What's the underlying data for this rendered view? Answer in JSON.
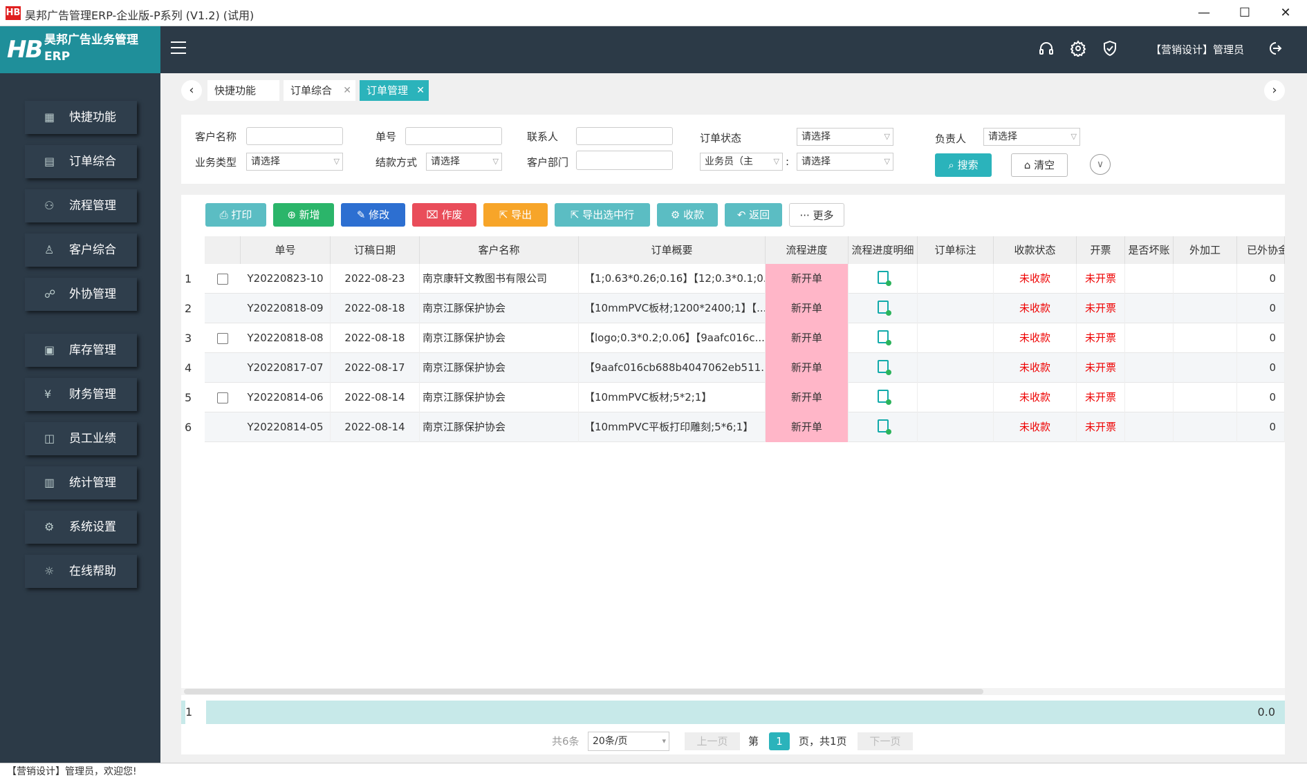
{
  "window": {
    "logo": "HB",
    "title": "昊邦广告管理ERP-企业版-P系列 (V1.2) (试用)",
    "minimize": "—",
    "maximize": "☐",
    "close": "✕"
  },
  "brand": {
    "logo": "HB",
    "name_line1": "昊邦广告业务管理",
    "name_line2": "ERP"
  },
  "header": {
    "user": "【营销设计】管理员",
    "icons": [
      "headset-icon",
      "gear-icon",
      "shield-check-icon",
      "logout-icon"
    ]
  },
  "sidebar": {
    "items": [
      {
        "label": "快捷功能",
        "icon": "grid-icon"
      },
      {
        "label": "订单综合",
        "icon": "clipboard-icon"
      },
      {
        "label": "流程管理",
        "icon": "flow-icon"
      },
      {
        "label": "客户综合",
        "icon": "user-icon"
      },
      {
        "label": "外协管理",
        "icon": "handshake-icon"
      },
      {
        "label": "库存管理",
        "icon": "inventory-icon"
      },
      {
        "label": "财务管理",
        "icon": "yen-icon"
      },
      {
        "label": "员工业绩",
        "icon": "chart-icon"
      },
      {
        "label": "统计管理",
        "icon": "bar-chart-icon"
      },
      {
        "label": "系统设置",
        "icon": "gear-icon"
      },
      {
        "label": "在线帮助",
        "icon": "bulb-icon"
      }
    ]
  },
  "tabs": [
    {
      "label": "快捷功能",
      "closable": false
    },
    {
      "label": "订单综合",
      "closable": true
    },
    {
      "label": "订单管理",
      "closable": true,
      "active": true
    }
  ],
  "filters": {
    "customer_name": "客户名称",
    "order_no": "单号",
    "contact": "联系人",
    "order_status": "订单状态",
    "order_status_value": "请选择",
    "owner": "负责人",
    "owner_value": "请选择",
    "biz_type": "业务类型",
    "biz_type_value": "请选择",
    "settle": "结款方式",
    "settle_value": "请选择",
    "dept": "客户部门",
    "salesman": "业务员（主",
    "salesman_sep": ":",
    "salesman_value": "请选择",
    "search": "搜索",
    "clear": "清空"
  },
  "toolbar": {
    "print": "打印",
    "add": "新增",
    "edit": "修改",
    "void": "作废",
    "export": "导出",
    "export_sel": "导出选中行",
    "collect": "收款",
    "back": "返回",
    "more": "更多"
  },
  "table": {
    "headers": [
      "单号",
      "订稿日期",
      "客户名称",
      "订单概要",
      "流程进度",
      "流程进度明细",
      "订单标注",
      "收款状态",
      "开票",
      "是否坏账",
      "外加工",
      "已外协金"
    ],
    "rows": [
      {
        "no": "1",
        "id": "Y20220823-10",
        "date": "2022-08-23",
        "customer": "南京康轩文教图书有限公司",
        "summary": "【1;0.63*0.26;0.16】【12;0.3*0.1;0...",
        "progress": "新开单",
        "pay": "未收款",
        "invoice": "未开票",
        "amount": "0"
      },
      {
        "no": "2",
        "id": "Y20220818-09",
        "date": "2022-08-18",
        "customer": "南京江豚保护协会",
        "summary": "【10mmPVC板材;1200*2400;1】【...",
        "progress": "新开单",
        "pay": "未收款",
        "invoice": "未开票",
        "amount": "0"
      },
      {
        "no": "3",
        "id": "Y20220818-08",
        "date": "2022-08-18",
        "customer": "南京江豚保护协会",
        "summary": "【logo;0.3*0.2;0.06】【9aafc016c...",
        "progress": "新开单",
        "pay": "未收款",
        "invoice": "未开票",
        "amount": "0"
      },
      {
        "no": "4",
        "id": "Y20220817-07",
        "date": "2022-08-17",
        "customer": "南京江豚保护协会",
        "summary": "【9aafc016cb688b4047062eb511...",
        "progress": "新开单",
        "pay": "未收款",
        "invoice": "未开票",
        "amount": "0"
      },
      {
        "no": "5",
        "id": "Y20220814-06",
        "date": "2022-08-14",
        "customer": "南京江豚保护协会",
        "summary": "【10mmPVC板材;5*2;1】",
        "progress": "新开单",
        "pay": "未收款",
        "invoice": "未开票",
        "amount": "0"
      },
      {
        "no": "6",
        "id": "Y20220814-05",
        "date": "2022-08-14",
        "customer": "南京江豚保护协会",
        "summary": "【10mmPVC平板打印雕刻;5*6;1】",
        "progress": "新开单",
        "pay": "未收款",
        "invoice": "未开票",
        "amount": "0"
      }
    ],
    "summary_no": "1",
    "summary_value": "0.0"
  },
  "pager": {
    "total": "共6条",
    "per_page": "20条/页",
    "prev": "上一页",
    "page_prefix": "第",
    "current": "1",
    "page_suffix": "页，共1页",
    "next": "下一页"
  },
  "status": "【营销设计】管理员，欢迎您!",
  "colors": {
    "accent": "#2bb3bb",
    "sidebar": "#2c3a47",
    "progress_bg": "#ffb6c8",
    "alert": "#e00000"
  }
}
